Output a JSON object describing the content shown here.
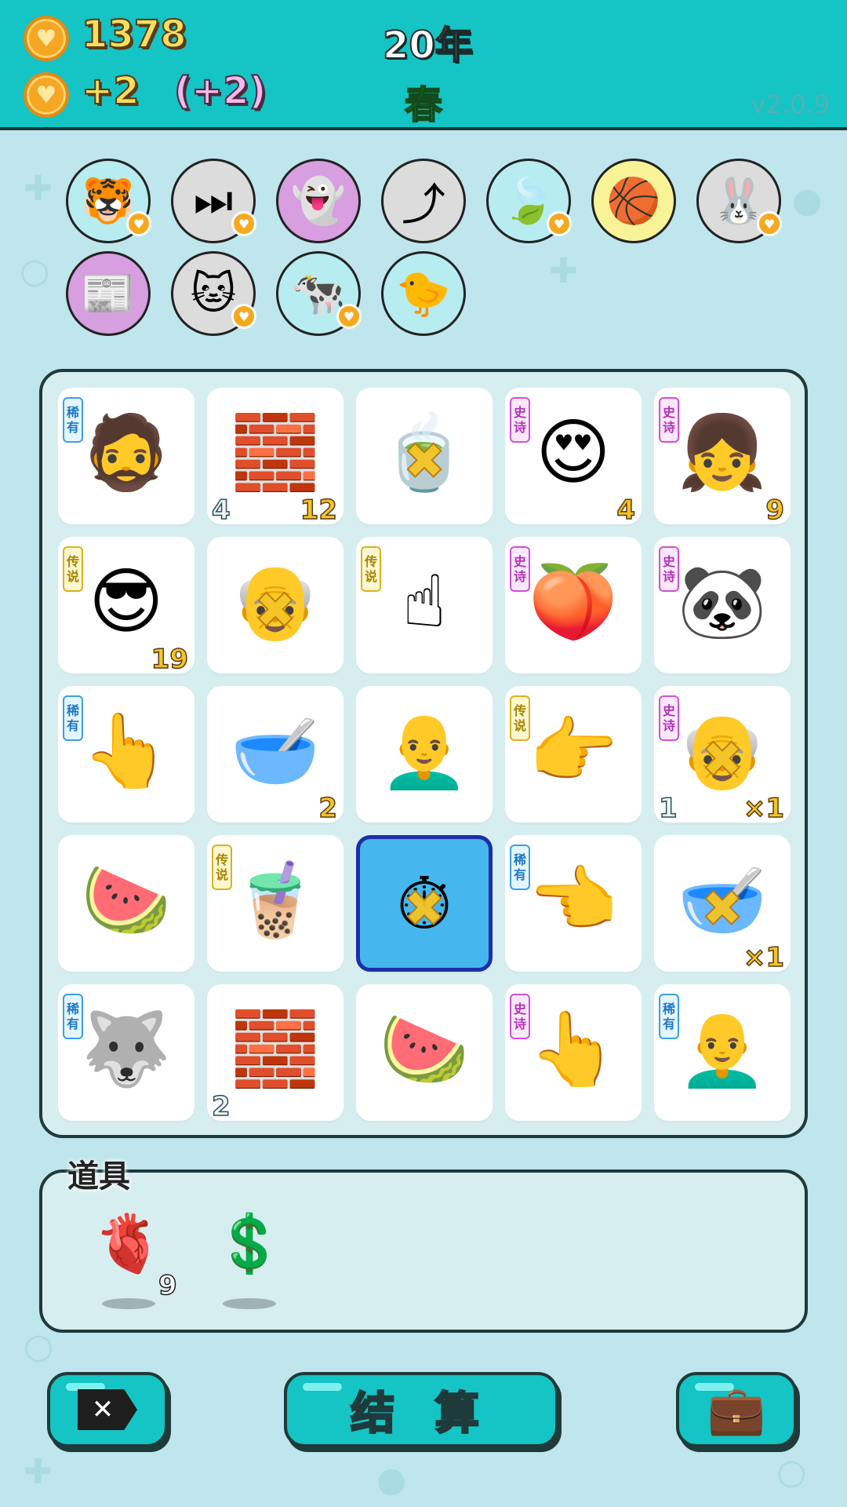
{
  "header": {
    "coins": "1378",
    "income": "+2",
    "income_bonus": "(+2)",
    "year": "20年",
    "season": "春",
    "version": "v2.0.9",
    "coin_icon": "heart-coin-icon"
  },
  "buffs": [
    {
      "name": "tiger-cat-buff",
      "icon": "🐯",
      "bg": "#b7ecf0",
      "heart": true
    },
    {
      "name": "skip-buff",
      "icon": "⏭",
      "bg": "#dcdcdc",
      "heart": true
    },
    {
      "name": "ghost-talisman-buff",
      "icon": "👻",
      "bg": "#d79ee0",
      "heart": false
    },
    {
      "name": "redirect-arrow-buff",
      "icon": "⤴",
      "bg": "#dcdcdc",
      "heart": false
    },
    {
      "name": "leaf-buff",
      "icon": "🍃",
      "bg": "#b7ecf0",
      "heart": true
    },
    {
      "name": "basketballs-buff",
      "icon": "🏀",
      "bg": "#f8f396",
      "heart": false
    },
    {
      "name": "rabbit-buff",
      "icon": "🐰",
      "bg": "#dcdcdc",
      "heart": true
    },
    {
      "name": "time-magazine-buff",
      "icon": "📰",
      "bg": "#d79ee0",
      "heart": false
    },
    {
      "name": "twin-cats-buff",
      "icon": "🐱",
      "bg": "#dcdcdc",
      "heart": true
    },
    {
      "name": "cow-pair-buff",
      "icon": "🐄",
      "bg": "#b7ecf0",
      "heart": true
    },
    {
      "name": "chicken-egg-buff",
      "icon": "🐤",
      "bg": "#b7ecf0",
      "heart": false
    }
  ],
  "tags": {
    "rare": "稀有",
    "epic": "史诗",
    "legend": "传说"
  },
  "board": [
    [
      {
        "name": "rapper-man",
        "icon": "🧔",
        "tag": "rare",
        "br": "",
        "bl": "",
        "x": false
      },
      {
        "name": "silver-bars",
        "icon": "🧱",
        "tag": "",
        "br": "12",
        "bl": "4",
        "x": false
      },
      {
        "name": "tea-bag",
        "icon": "🍵",
        "tag": "",
        "br": "",
        "bl": "",
        "x": true
      },
      {
        "name": "heart-eyes-man",
        "icon": "😍",
        "tag": "epic",
        "br": "4",
        "bl": "",
        "x": false
      },
      {
        "name": "braid-girl",
        "icon": "👧",
        "tag": "epic",
        "br": "9",
        "bl": "",
        "x": false
      }
    ],
    [
      {
        "name": "sunglasses-man",
        "icon": "😎",
        "tag": "legend",
        "br": "19",
        "bl": "",
        "x": false
      },
      {
        "name": "old-man-glasses",
        "icon": "👴",
        "tag": "",
        "br": "",
        "bl": "",
        "x": true
      },
      {
        "name": "pointing-up-hand",
        "icon": "☝",
        "tag": "legend",
        "br": "",
        "bl": "",
        "x": false
      },
      {
        "name": "peach",
        "icon": "🍑",
        "tag": "epic",
        "br": "",
        "bl": "",
        "x": false
      },
      {
        "name": "panda",
        "icon": "🐼",
        "tag": "epic",
        "br": "",
        "bl": "",
        "x": false
      }
    ],
    [
      {
        "name": "brown-pointing-hand",
        "icon": "👆",
        "tag": "rare",
        "br": "",
        "bl": "",
        "x": false
      },
      {
        "name": "tea-bowl",
        "icon": "🥣",
        "tag": "",
        "br": "2",
        "bl": "",
        "x": false
      },
      {
        "name": "bald-old-man",
        "icon": "👨‍🦲",
        "tag": "",
        "br": "",
        "bl": "",
        "x": false
      },
      {
        "name": "pointing-right-hand",
        "icon": "👉",
        "tag": "legend",
        "br": "",
        "bl": "",
        "x": false
      },
      {
        "name": "old-man-frown",
        "icon": "👴",
        "tag": "epic",
        "br": "×1",
        "bl": "1",
        "x": true
      }
    ],
    [
      {
        "name": "watermelon",
        "icon": "🍉",
        "tag": "",
        "br": "",
        "bl": "",
        "x": false
      },
      {
        "name": "milk-tea",
        "icon": "🧋",
        "tag": "legend",
        "br": "",
        "bl": "",
        "x": false
      },
      {
        "name": "stopwatch",
        "icon": "⏱",
        "tag": "",
        "br": "",
        "bl": "",
        "x": true,
        "highlight": true
      },
      {
        "name": "brown-left-hand",
        "icon": "👈",
        "tag": "rare",
        "br": "",
        "bl": "",
        "x": false
      },
      {
        "name": "soup-bowl",
        "icon": "🥣",
        "tag": "",
        "br": "×1",
        "bl": "",
        "x": true
      }
    ],
    [
      {
        "name": "husky-dog",
        "icon": "🐺",
        "tag": "rare",
        "br": "",
        "bl": "",
        "x": false
      },
      {
        "name": "silver-bars",
        "icon": "🧱",
        "tag": "",
        "br": "",
        "bl": "2",
        "x": false
      },
      {
        "name": "watermelon",
        "icon": "🍉",
        "tag": "",
        "br": "",
        "bl": "",
        "x": false
      },
      {
        "name": "grey-pointing-hand",
        "icon": "👆",
        "tag": "epic",
        "br": "",
        "bl": "",
        "x": false
      },
      {
        "name": "bald-man",
        "icon": "👨‍🦲",
        "tag": "rare",
        "br": "",
        "bl": "",
        "x": false
      }
    ]
  ],
  "props": {
    "label": "道具",
    "items": [
      {
        "name": "liver-prop",
        "icon": "🫀",
        "count": "9"
      },
      {
        "name": "dollar-coin-prop",
        "icon": "💲",
        "count": ""
      }
    ]
  },
  "buttons": {
    "close_icon": "✕",
    "settle_label": "结 算",
    "bag_icon": "💼"
  }
}
